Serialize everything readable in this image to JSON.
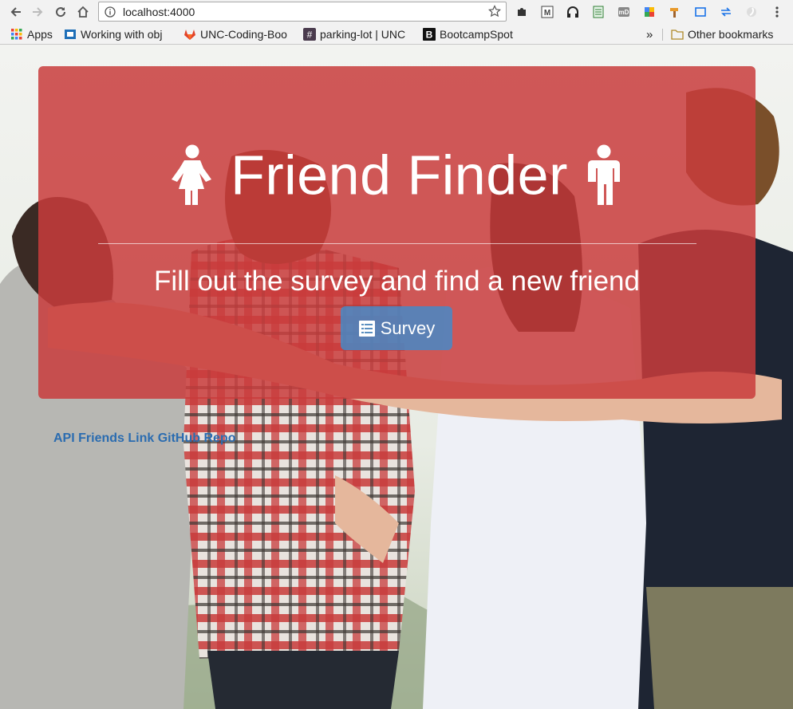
{
  "browser": {
    "url": "localhost:4000",
    "bookmarks": [
      {
        "label": "Apps",
        "icon": "apps-grid-icon"
      },
      {
        "label": "Working with obj",
        "icon": "bookmark-page-icon"
      },
      {
        "label": "UNC-Coding-Boo",
        "icon": "gitlab-icon"
      },
      {
        "label": "parking-lot | UNC",
        "icon": "slack-hash-icon"
      },
      {
        "label": "BootcampSpot",
        "icon": "bootcampspot-icon"
      }
    ],
    "overflow": "»",
    "other_bookmarks": "Other bookmarks"
  },
  "page": {
    "title": "Friend Finder",
    "subtitle": "Fill out the survey and find a new friend",
    "survey_button": "Survey",
    "links": {
      "api_friends": "API Friends Link",
      "github_repo": "GitHub Repo"
    }
  },
  "colors": {
    "jumbotron": "#c93c3c",
    "button": "#428bca",
    "link": "#2b6cb0"
  }
}
